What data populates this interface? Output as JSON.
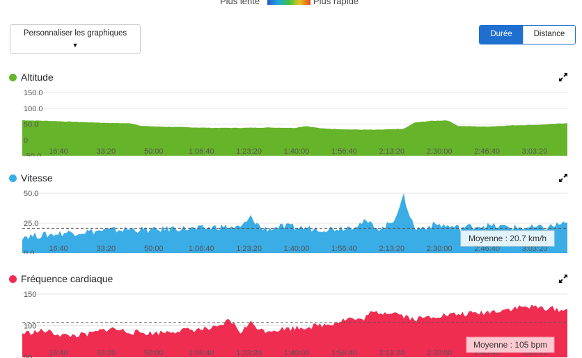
{
  "legend": {
    "slow": "Plus lente",
    "fast": "Plus rapide"
  },
  "customize": {
    "label": "Personnaliser les graphiques"
  },
  "toggle": {
    "duration": "Durée",
    "distance": "Distance"
  },
  "x_ticks": [
    "16:40",
    "33:20",
    "50:00",
    "1:06:40",
    "1:23:20",
    "1:40:00",
    "1:56:40",
    "2:13:20",
    "2:30:00",
    "2:46:40",
    "3:03:20"
  ],
  "charts": [
    {
      "key": "altitude",
      "title": "Altitude",
      "color": "#66b42a",
      "avg_label": ""
    },
    {
      "key": "speed",
      "title": "Vitesse",
      "color": "#3aace6",
      "avg_label": "Moyenne : 20.7 km/h"
    },
    {
      "key": "hr",
      "title": "Fréquence cardiaque",
      "color": "#ef2d51",
      "avg_label": "Moyenne : 105 bpm"
    }
  ],
  "chart_data": [
    {
      "type": "area",
      "title": "Altitude",
      "ylim": [
        -50,
        150
      ],
      "yticks": [
        "150.0",
        "100.0",
        "50.0",
        "0",
        "-50.0"
      ],
      "x": [
        0,
        0.05,
        0.1,
        0.15,
        0.2,
        0.22,
        0.25,
        0.3,
        0.35,
        0.4,
        0.45,
        0.5,
        0.52,
        0.55,
        0.6,
        0.65,
        0.7,
        0.72,
        0.75,
        0.78,
        0.8,
        0.85,
        0.9,
        0.95,
        1.0
      ],
      "values": [
        62,
        60,
        57,
        54,
        52,
        44,
        42,
        40,
        38,
        38,
        39,
        38,
        44,
        36,
        33,
        32,
        35,
        55,
        60,
        62,
        44,
        42,
        46,
        48,
        53
      ],
      "grid": true
    },
    {
      "type": "area",
      "title": "Vitesse",
      "ylim": [
        0,
        50
      ],
      "yticks": [
        "50.0",
        "25.0",
        "0.0"
      ],
      "average": 20.7,
      "x": [
        0,
        0.04,
        0.08,
        0.12,
        0.16,
        0.2,
        0.24,
        0.28,
        0.32,
        0.36,
        0.4,
        0.42,
        0.44,
        0.48,
        0.52,
        0.56,
        0.6,
        0.63,
        0.66,
        0.68,
        0.7,
        0.72,
        0.76,
        0.8,
        0.84,
        0.88,
        0.92,
        0.96,
        1.0
      ],
      "values": [
        14,
        15,
        17,
        18,
        19,
        20,
        19,
        21,
        20,
        22,
        21,
        30,
        20,
        22,
        21,
        20,
        22,
        26,
        20,
        27,
        47,
        20,
        24,
        21,
        23,
        22,
        21,
        21,
        26
      ],
      "grid": true
    },
    {
      "type": "area",
      "title": "Fréquence cardiaque",
      "ylim": [
        50,
        150
      ],
      "yticks": [
        "150",
        "100",
        "50"
      ],
      "average": 105,
      "x": [
        0,
        0.04,
        0.08,
        0.12,
        0.16,
        0.2,
        0.24,
        0.28,
        0.32,
        0.36,
        0.38,
        0.4,
        0.42,
        0.44,
        0.48,
        0.52,
        0.56,
        0.6,
        0.62,
        0.64,
        0.68,
        0.72,
        0.76,
        0.8,
        0.84,
        0.88,
        0.92,
        0.96,
        1.0
      ],
      "values": [
        88,
        92,
        84,
        86,
        96,
        90,
        88,
        92,
        94,
        96,
        110,
        90,
        105,
        92,
        95,
        98,
        102,
        112,
        108,
        120,
        122,
        110,
        116,
        118,
        120,
        125,
        130,
        128,
        124
      ],
      "grid": true
    }
  ]
}
